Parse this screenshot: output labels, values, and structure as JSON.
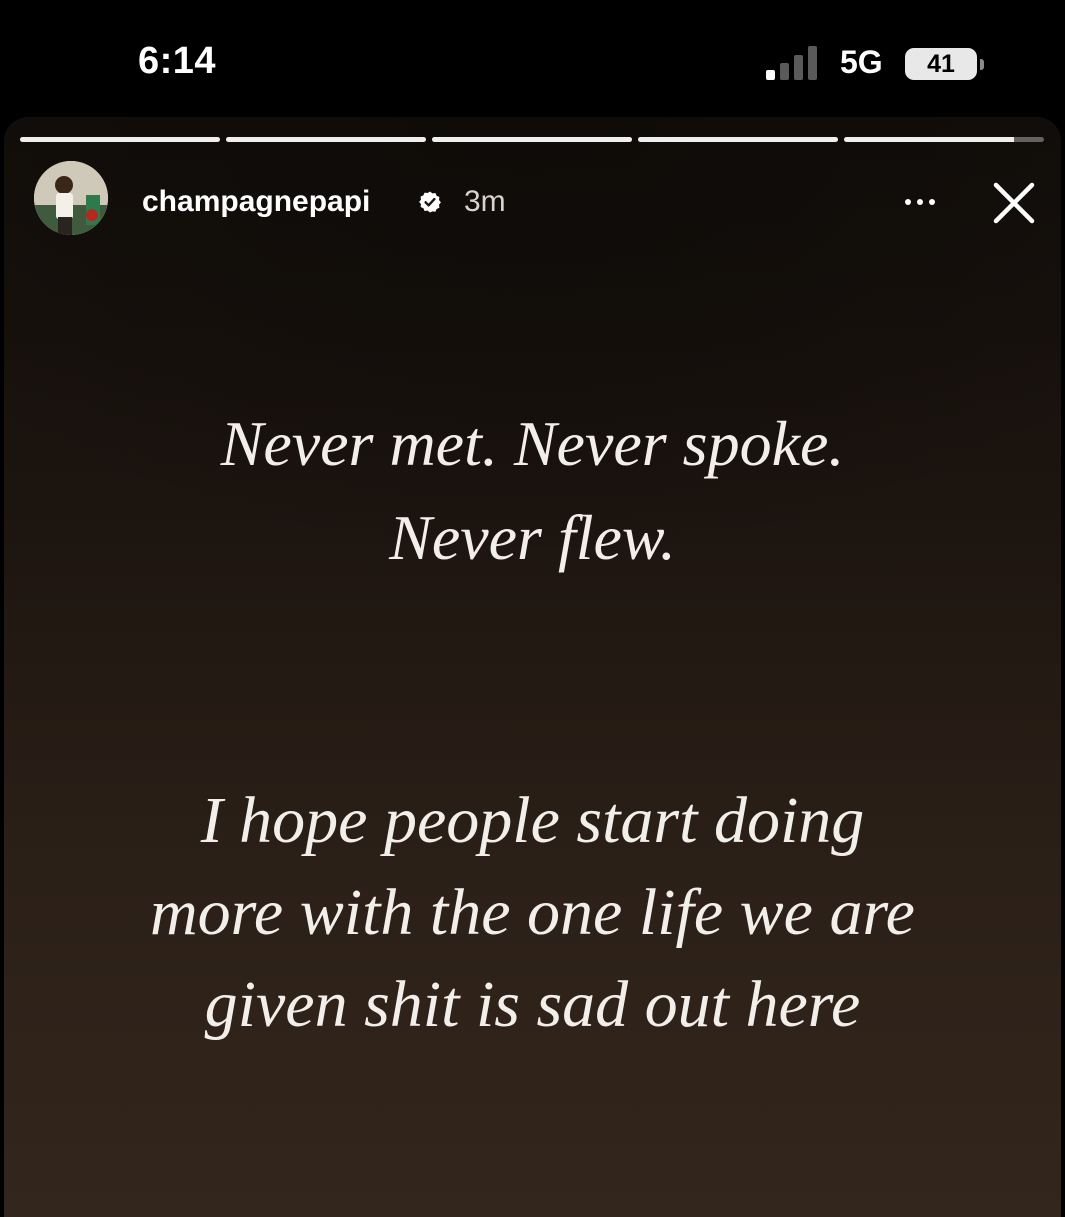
{
  "status_bar": {
    "time": "6:14",
    "network": "5G",
    "battery": "41"
  },
  "story": {
    "progress_segments": 5,
    "active_segment_progress": 0.85,
    "user": {
      "username": "champagnepapi",
      "time_ago": "3m"
    },
    "text_block_1": [
      "Never met. Never spoke.",
      "Never flew."
    ],
    "text_block_2": [
      "I hope people start doing",
      "more with the one life we are",
      "given shit is sad out here"
    ]
  }
}
